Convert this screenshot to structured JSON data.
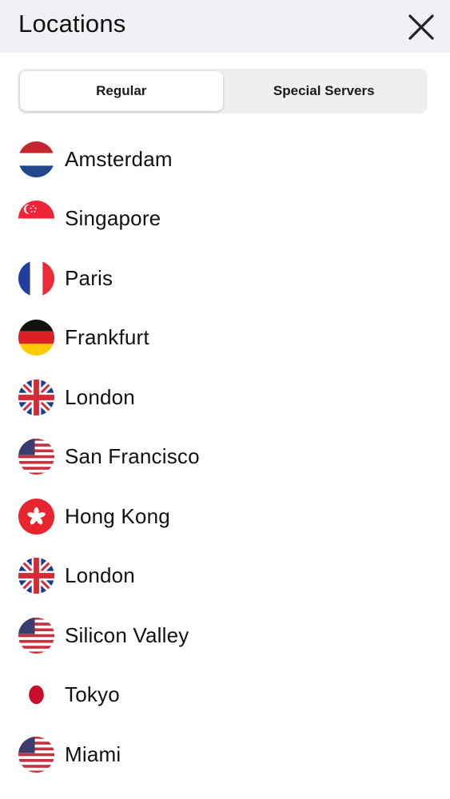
{
  "header": {
    "title": "Locations",
    "close_icon": "close-icon"
  },
  "tabs": [
    {
      "label": "Regular",
      "selected": true
    },
    {
      "label": "Special Servers",
      "selected": false
    }
  ],
  "locations": [
    {
      "city": "Amsterdam",
      "flag": "netherlands-flag-icon"
    },
    {
      "city": "Singapore",
      "flag": "singapore-flag-icon"
    },
    {
      "city": "Paris",
      "flag": "france-flag-icon"
    },
    {
      "city": "Frankfurt",
      "flag": "germany-flag-icon"
    },
    {
      "city": "London",
      "flag": "uk-flag-icon"
    },
    {
      "city": "San Francisco",
      "flag": "usa-flag-icon"
    },
    {
      "city": "Hong Kong",
      "flag": "hong-kong-flag-icon"
    },
    {
      "city": "London",
      "flag": "uk-flag-icon"
    },
    {
      "city": "Silicon Valley",
      "flag": "usa-flag-icon"
    },
    {
      "city": "Tokyo",
      "flag": "japan-flag-icon"
    },
    {
      "city": "Miami",
      "flag": "usa-flag-icon"
    }
  ],
  "colors": {
    "header_bg": "#f1f1f5",
    "segment_bg": "#efeff1",
    "text": "#111111"
  }
}
